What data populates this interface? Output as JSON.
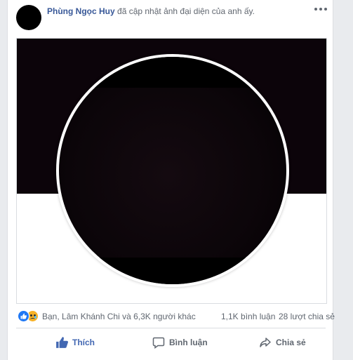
{
  "post": {
    "author": "Phùng Ngọc Huy",
    "action": "đã cập nhật ảnh đại diện của anh ấy."
  },
  "reactions": {
    "icons": [
      "like-reaction-icon",
      "sad-reaction-icon"
    ],
    "summary": "Bạn, Lâm Khánh Chi và 6,3K người khác",
    "comments": "1,1K bình luận",
    "shares": "28 lượt chia sẻ"
  },
  "actions": {
    "like_label": "Thích",
    "comment_label": "Bình luận",
    "share_label": "Chia sẻ"
  },
  "colors": {
    "author_link": "#385898",
    "like_active": "#4267b2",
    "cover_bg": "#0c040a",
    "like_reaction": "#2078f4",
    "sad_reaction": "#f7b125"
  }
}
